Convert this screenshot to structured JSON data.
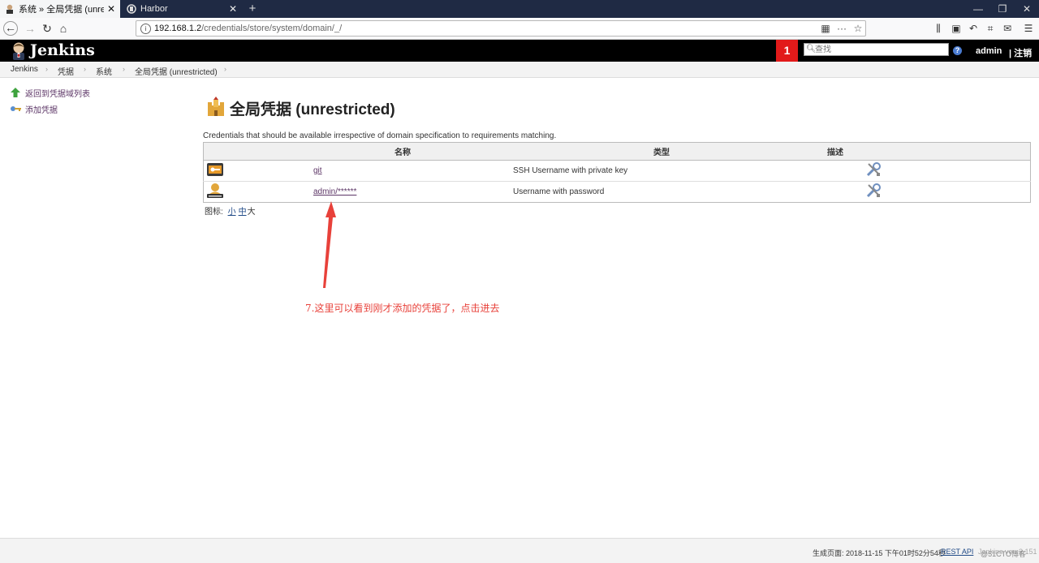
{
  "browser": {
    "tabs": [
      {
        "label": "系统 » 全局凭据 (unrestricted)"
      },
      {
        "label": "Harbor"
      }
    ],
    "new_tab": "+",
    "url": {
      "host": "192.168.1.2",
      "path": "/credentials/store/system/domain/_/"
    },
    "menu_dots": "···"
  },
  "jenkins": {
    "name": "Jenkins",
    "notification_count": "1",
    "search_placeholder": "查找",
    "user": "admin",
    "logout": "| 注销"
  },
  "breadcrumb": [
    "Jenkins",
    "凭据",
    "系统",
    "全局凭据 (unrestricted)"
  ],
  "sidebar": {
    "items": [
      {
        "label": "返回到凭据域列表",
        "icon": "green-up-arrow-icon"
      },
      {
        "label": "添加凭据",
        "icon": "key-icon"
      }
    ]
  },
  "main": {
    "title": "全局凭据 (unrestricted)",
    "description": "Credentials that should be available irrespective of domain specification to requirements matching.",
    "table": {
      "headers": [
        "名称",
        "类型",
        "描述"
      ],
      "rows": [
        {
          "name": "git",
          "type": "SSH Username with private key",
          "icon": "ssh-key-icon"
        },
        {
          "name": "admin/******",
          "type": "Username with password",
          "icon": "user-password-icon"
        }
      ]
    },
    "icon_size": {
      "label": "图标:",
      "small": "小",
      "medium": "中",
      "large": "大"
    }
  },
  "annotation": "7.这里可以看到刚才添加的凭据了，点击进去",
  "footer": {
    "generated": "生成页面: 2018-11-15 下午01时52分54秒",
    "rest_api": "REST API",
    "version": "Jenkins ver. 2.151"
  },
  "watermark": "@51CTO博客",
  "colors": {
    "header_bg": "#000000",
    "notification": "#e21a1a",
    "link": "#5c3566",
    "annotation": "#e8413a"
  }
}
